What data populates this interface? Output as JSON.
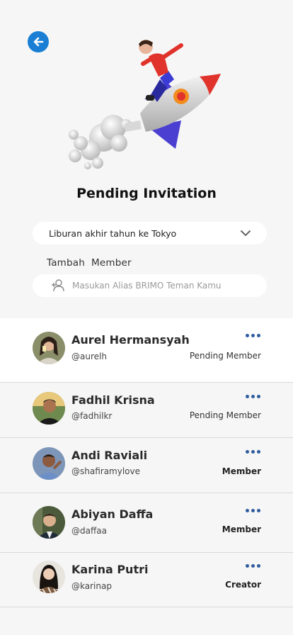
{
  "header": {
    "title": "Pending Invitation"
  },
  "trip_select": {
    "selected": "Liburan akhir tahun ke Tokyo"
  },
  "add_member": {
    "label": "Tambah  Member",
    "placeholder": "Masukan Alias BRIMO Teman Kamu"
  },
  "colors": {
    "accent": "#1a7fd4",
    "more_dots": "#2f5c9e",
    "background": "#f6f6f6"
  },
  "members": [
    {
      "name": "Aurel Hermansyah",
      "handle": "@aurelh",
      "status": "Pending Member"
    },
    {
      "name": "Fadhil Krisna",
      "handle": "@fadhilkr",
      "status": "Pending Member"
    },
    {
      "name": "Andi Raviali",
      "handle": "@shafiramylove",
      "status": "Member"
    },
    {
      "name": "Abiyan Daffa",
      "handle": "@daffaa",
      "status": "Member"
    },
    {
      "name": "Karina Putri",
      "handle": "@karinap",
      "status": "Creator"
    }
  ]
}
